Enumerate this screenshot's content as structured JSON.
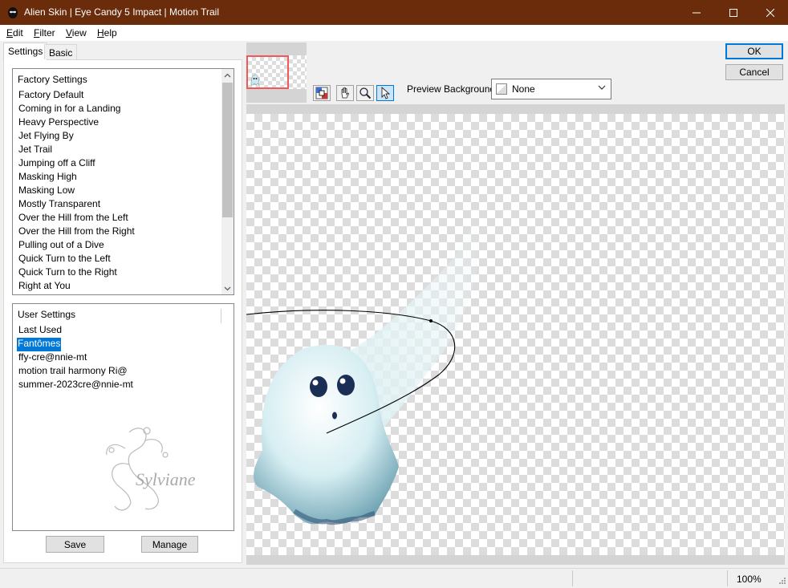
{
  "window": {
    "title": "Alien Skin | Eye Candy 5 Impact | Motion Trail",
    "title_bar_color": "#6b2c0c"
  },
  "menu": {
    "items": [
      "Edit",
      "Filter",
      "View",
      "Help"
    ]
  },
  "tabs": {
    "settings": "Settings",
    "basic": "Basic"
  },
  "factory_settings": {
    "header": "Factory Settings",
    "items": [
      "Factory Default",
      "Coming in for a Landing",
      "Heavy Perspective",
      "Jet Flying By",
      "Jet Trail",
      "Jumping off a Cliff",
      "Masking High",
      "Masking Low",
      "Mostly Transparent",
      "Over the Hill from the Left",
      "Over the Hill from the Right",
      "Pulling out of a Dive",
      "Quick Turn to the Left",
      "Quick Turn to the Right",
      "Right at You"
    ]
  },
  "user_settings": {
    "header": "User Settings",
    "items": [
      "Last Used",
      "Fantômes",
      "ffy-cre@nnie-mt",
      "motion trail harmony Ri@",
      "summer-2023cre@nnie-mt"
    ],
    "selected_index": 1,
    "watermark": "Sylviane"
  },
  "buttons": {
    "save": "Save",
    "manage": "Manage",
    "ok": "OK",
    "cancel": "Cancel"
  },
  "preview_background": {
    "label": "Preview Background:",
    "value": "None"
  },
  "tools": [
    "preview-icon",
    "hand-icon",
    "zoom-icon",
    "arrow-select-icon"
  ],
  "status": {
    "zoom": "100%"
  },
  "colors": {
    "selection": "#0078d7",
    "thumbnail_border": "#ee5a5a"
  }
}
